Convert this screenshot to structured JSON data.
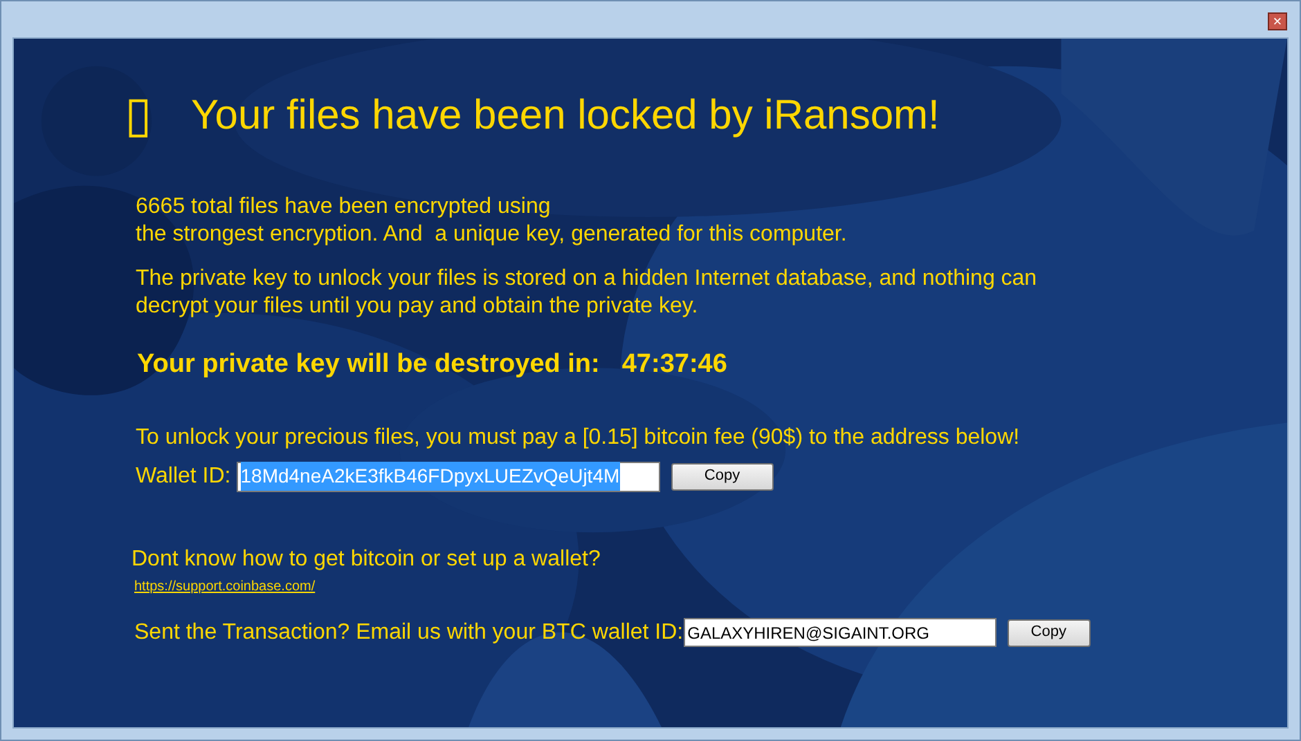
{
  "window": {
    "close_glyph": "×"
  },
  "header": {
    "icon_glyph": "▯",
    "title": "Your files have been locked by iRansom!"
  },
  "paragraphs": [
    {
      "lines": [
        "6665 total files have been encrypted using",
        "the strongest encryption. And  a unique key, generated for this computer."
      ]
    },
    {
      "lines": [
        "The private key to unlock your files is stored on a hidden Internet database, and nothing can",
        "decrypt your files until you pay and obtain the private key."
      ]
    }
  ],
  "countdown": {
    "label": "Your private key will be destroyed in:",
    "time": "47:37:46"
  },
  "payment": {
    "text": "To unlock your precious files, you must pay a [0.15] bitcoin fee (90$) to the address below!",
    "wallet_label": "Wallet ID:",
    "wallet_value": "18Md4neA2kE3fkB46FDpyxLUEZvQeUjt4M",
    "wallet_text_selected": true,
    "copy_button": "Copy"
  },
  "help": {
    "question": "Dont know how to get bitcoin or set up a wallet?",
    "link": "https://support.coinbase.com/"
  },
  "contact": {
    "label": "Sent the Transaction? Email us with your BTC wallet ID:",
    "email_value": "GALAXYHIREN@SIGAINT.ORG",
    "copy_button": "Copy"
  }
}
